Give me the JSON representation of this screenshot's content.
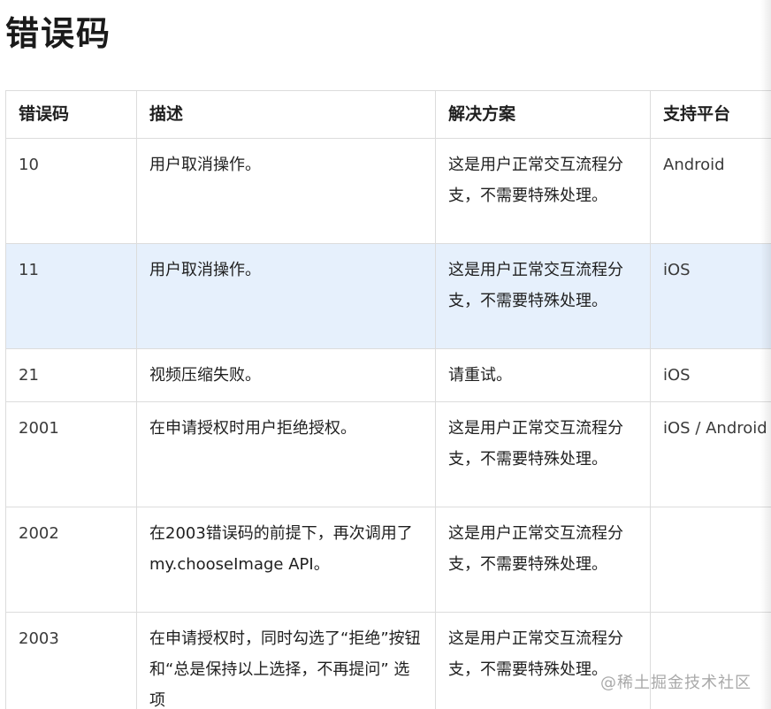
{
  "heading": "错误码",
  "table": {
    "headers": [
      "错误码",
      "描述",
      "解决方案",
      "支持平台"
    ],
    "rows": [
      {
        "code": "10",
        "desc": "用户取消操作。",
        "solution": "这是用户正常交互流程分支，不需要特殊处理。",
        "platform": "Android"
      },
      {
        "code": "11",
        "desc": "用户取消操作。",
        "solution": "这是用户正常交互流程分支，不需要特殊处理。",
        "platform": "iOS"
      },
      {
        "code": "21",
        "desc": "视频压缩失败。",
        "solution": "请重试。",
        "platform": "iOS"
      },
      {
        "code": "2001",
        "desc": "在申请授权时用户拒绝授权。",
        "solution": "这是用户正常交互流程分支，不需要特殊处理。",
        "platform": "iOS / Android"
      },
      {
        "code": "2002",
        "desc": "在2003错误码的前提下，再次调用了 my.chooseImage API。",
        "solution": "这是用户正常交互流程分支，不需要特殊处理。",
        "platform": ""
      },
      {
        "code": "2003",
        "desc": "在申请授权时，同时勾选了“拒绝”按钮和“总是保持以上选择，不再提问” 选项",
        "solution": "这是用户正常交互流程分支，不需要特殊处理。",
        "platform": ""
      }
    ]
  },
  "watermark": "@稀土掘金技术社区"
}
